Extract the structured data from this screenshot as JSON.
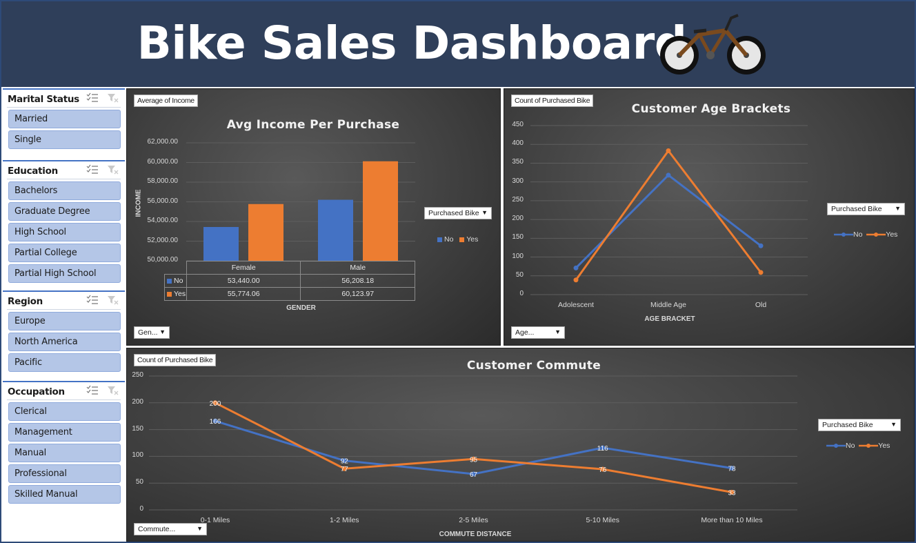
{
  "header": {
    "title": "Bike Sales Dashboard",
    "logo_icon": "bicycle-icon"
  },
  "colors": {
    "no": "#4472c4",
    "yes": "#ed7d31",
    "header_bg": "#2f3f5a",
    "slicer_item": "#b4c6e7"
  },
  "slicers": [
    {
      "title": "Marital Status",
      "items": [
        "Married",
        "Single"
      ]
    },
    {
      "title": "Education",
      "items": [
        "Bachelors",
        "Graduate Degree",
        "High School",
        "Partial College",
        "Partial High School"
      ]
    },
    {
      "title": "Region",
      "items": [
        "Europe",
        "North America",
        "Pacific"
      ]
    },
    {
      "title": "Occupation",
      "items": [
        "Clerical",
        "Management",
        "Manual",
        "Professional",
        "Skilled Manual"
      ]
    }
  ],
  "income_chart": {
    "field_button": "Average of Income",
    "legend_filter": "Purchased Bike",
    "axis_filter": "Gen...",
    "legend": [
      "No",
      "Yes"
    ],
    "table_values": {
      "no_female": "53,440.00",
      "no_male": "56,208.18",
      "yes_female": "55,774.06",
      "yes_male": "60,123.97"
    },
    "y_ticks": [
      "62,000.00",
      "60,000.00",
      "58,000.00",
      "56,000.00",
      "54,000.00",
      "52,000.00",
      "50,000.00"
    ]
  },
  "age_chart": {
    "field_button": "Count of Purchased Bike",
    "legend_filter": "Purchased Bike",
    "axis_filter": "Age...",
    "legend": [
      "No",
      "Yes"
    ],
    "y_ticks": [
      "450",
      "400",
      "350",
      "300",
      "250",
      "200",
      "150",
      "100",
      "50",
      "0"
    ]
  },
  "commute_chart": {
    "field_button": "Count of Purchased Bike",
    "legend_filter": "Purchased Bike",
    "axis_filter": "Commute...",
    "legend": [
      "No",
      "Yes"
    ],
    "y_ticks": [
      "250",
      "200",
      "150",
      "100",
      "50",
      "0"
    ]
  },
  "chart_data": [
    {
      "type": "bar",
      "title": "Avg Income Per Purchase",
      "xlabel": "GENDER",
      "ylabel": "INCOME",
      "categories": [
        "Female",
        "Male"
      ],
      "series": [
        {
          "name": "No",
          "values": [
            53440.0,
            56208.18
          ]
        },
        {
          "name": "Yes",
          "values": [
            55774.06,
            60123.97
          ]
        }
      ],
      "ylim": [
        50000,
        62000
      ],
      "grid": true,
      "legend": "right"
    },
    {
      "type": "line",
      "title": "Customer Age Brackets",
      "xlabel": "AGE BRACKET",
      "ylabel": "",
      "categories": [
        "Adolescent",
        "Middle Age",
        "Old"
      ],
      "series": [
        {
          "name": "No",
          "values": [
            71,
            318,
            130
          ]
        },
        {
          "name": "Yes",
          "values": [
            39,
            383,
            59
          ]
        }
      ],
      "ylim": [
        0,
        450
      ],
      "grid": true,
      "legend": "right"
    },
    {
      "type": "line",
      "title": "Customer Commute",
      "xlabel": "COMMUTE DISTANCE",
      "ylabel": "",
      "categories": [
        "0-1 Miles",
        "1-2 Miles",
        "2-5 Miles",
        "5-10 Miles",
        "More than 10 Miles"
      ],
      "series": [
        {
          "name": "No",
          "values": [
            166,
            92,
            67,
            116,
            78
          ]
        },
        {
          "name": "Yes",
          "values": [
            200,
            77,
            95,
            76,
            33
          ]
        }
      ],
      "ylim": [
        0,
        250
      ],
      "grid": true,
      "legend": "right"
    }
  ]
}
